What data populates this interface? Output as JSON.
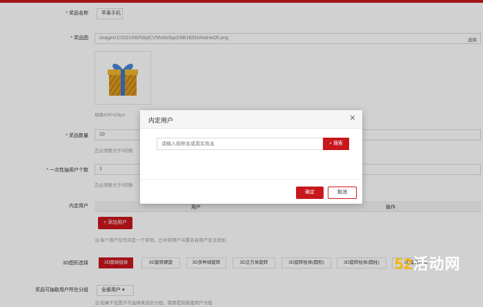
{
  "form": {
    "prize_name_label": "奖品名称",
    "prize_name_value": "苹果手机",
    "prize_image_label": "奖品图",
    "prize_image_path": "images/1/2021/06/N9jdCV5fv9io5qxD9B1BSDAVaHxOfl.png",
    "select_image_label": "选择",
    "image_hint": "规格428*428px",
    "prize_count_label": "奖品数量",
    "prize_count_value": "10",
    "prize_count_hint": "正必须要大于0的数",
    "per_user_label": "一次性抽用户个数",
    "per_user_value": "1",
    "per_user_hint": "正必须要大于0的数",
    "inner_user_label": "内定用户",
    "table_col_user": "用户",
    "table_col_action": "操作",
    "add_user_label": "+ 添加用户",
    "add_user_hint": "注:每个用户仅作内定一个奖项，已中奖用户与重名者用户无法添加",
    "shape_label": "3D图形选择",
    "shapes": [
      "3D圆球组球",
      "3D旋转螺旋",
      "3D多种球旋转",
      "3D正方体旋转",
      "3D旋转柱体(圆形)",
      "3D旋转柱体(圆柱)",
      "3D旋转柱体"
    ],
    "group_label": "奖品可抽取用户所在分组",
    "group_value": "全部用户",
    "group_hint": "注:如果不设置不可选择来自此分组，需要提前新建用户分组"
  },
  "modal": {
    "title": "内定用户",
    "search_placeholder": "请输入昵称名或真实姓名",
    "search_button": "搜索",
    "confirm_button": "确定",
    "cancel_button": "取消"
  },
  "watermark": {
    "num": "52",
    "text": "活动网"
  },
  "colors": {
    "accent": "#c8161d",
    "watermark": "#f7b500"
  }
}
